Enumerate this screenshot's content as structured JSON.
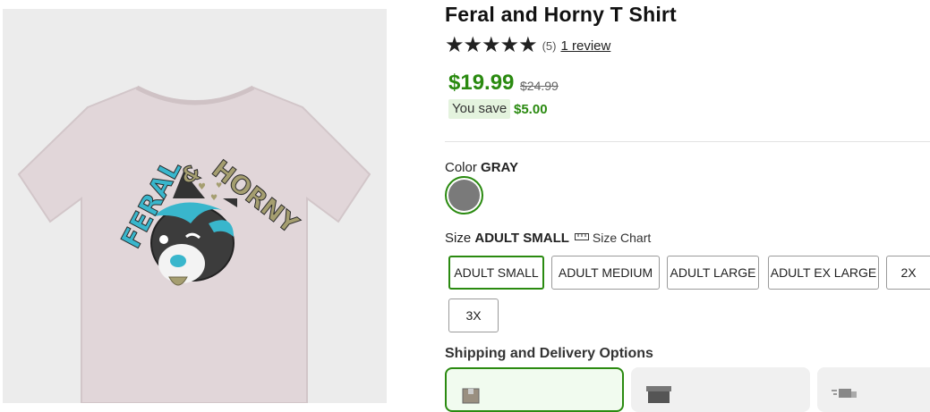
{
  "product": {
    "title": "Feral and Horny T Shirt",
    "rating_count": "(5)",
    "review_link": "1 review",
    "price": "$19.99",
    "old_price": "$24.99",
    "you_save_label": "You save",
    "save_amount": "$5.00"
  },
  "image": {
    "text_feral": "FERAL",
    "text_amp": "&",
    "text_horny": "HORNY",
    "shirt_color": "#e1d6d9",
    "accent_teal": "#39b6cc",
    "accent_olive": "#a59e70"
  },
  "color": {
    "label": "Color",
    "value": "GRAY",
    "swatch": "#7a7a7a"
  },
  "size": {
    "label": "Size",
    "value": "ADULT SMALL",
    "chart_label": "Size Chart",
    "options": [
      "ADULT SMALL",
      "ADULT MEDIUM",
      "ADULT LARGE",
      "ADULT EX LARGE",
      "2X",
      "3X"
    ]
  },
  "shipping": {
    "title": "Shipping and Delivery Options"
  },
  "theme": {
    "accent_green": "#2a8a10"
  }
}
